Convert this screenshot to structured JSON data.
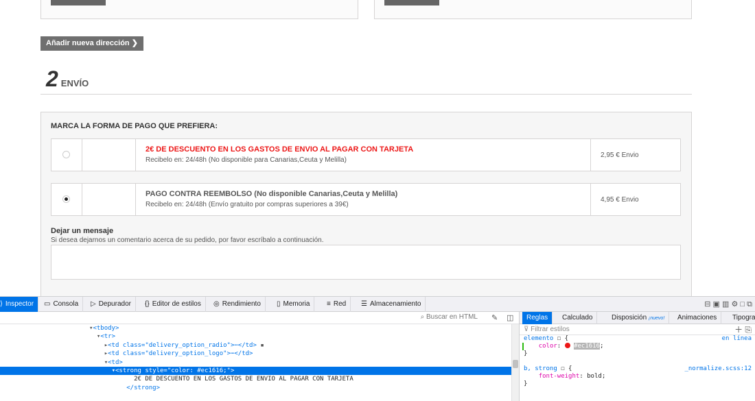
{
  "page": {
    "add_address_button": "Añadir nueva dirección",
    "step_number": "2",
    "step_title": "ENVÍO",
    "payment_heading": "MARCA LA FORMA DE PAGO QUE PREFIERA:",
    "options": [
      {
        "title": "2€ DE DESCUENTO EN LOS GASTOS DE ENVIO AL PAGAR CON TARJETA",
        "subtitle": "Recibelo en: 24/48h (No disponible para Canarias,Ceuta y Melilla)",
        "price": "2,95 € Envio",
        "selected": false,
        "title_color": "#ec1616"
      },
      {
        "title": "PAGO CONTRA REEMBOLSO (No disponible Canarias,Ceuta y Melilla)",
        "subtitle": "Recibelo en: 24/48h (Envío gratuito por compras superiores a 39€)",
        "price": "4,95 € Envio",
        "selected": true,
        "title_color": "#555555"
      }
    ],
    "message_label": "Dejar un mensaje",
    "message_hint": "Si desea dejarnos un comentario acerca de su pedido, por favor escríbalo a continuación."
  },
  "devtools": {
    "tabs": [
      {
        "label": "Inspector",
        "icon": "inspector-icon",
        "active": true
      },
      {
        "label": "Consola",
        "icon": "console-icon"
      },
      {
        "label": "Depurador",
        "icon": "debugger-icon"
      },
      {
        "label": "Editor de estilos",
        "icon": "style-editor-icon"
      },
      {
        "label": "Rendimiento",
        "icon": "performance-icon"
      },
      {
        "label": "Memoria",
        "icon": "memory-icon"
      },
      {
        "label": "Red",
        "icon": "network-icon"
      },
      {
        "label": "Almacenamiento",
        "icon": "storage-icon"
      }
    ],
    "search_placeholder": "Buscar en HTML",
    "tree": [
      {
        "text": "<tbody>"
      },
      {
        "text": "<tr>"
      },
      {
        "text": "<td class=\"delivery_option_radio\">⋯</td>"
      },
      {
        "text": "<td class=\"delivery_option_logo\">⋯</td>"
      },
      {
        "text": "<td>"
      },
      {
        "text": "<strong style=\"color: #ec1616;\">",
        "selected": true
      },
      {
        "text": "2€ DE DESCUENTO EN LOS GASTOS DE ENVIO AL PAGAR CON TARJETA"
      },
      {
        "text": "</strong>"
      }
    ],
    "rule_tabs": [
      {
        "label": "Reglas",
        "active": true
      },
      {
        "label": "Calculado"
      },
      {
        "label": "Disposición",
        "badge": "¡nuevo!"
      },
      {
        "label": "Animaciones"
      },
      {
        "label": "Tipografías"
      }
    ],
    "filter_placeholder": "Filtrar estilos",
    "rules": {
      "element_selector": "elemento",
      "element_source": "en línea",
      "color_prop": "color",
      "color_value": "#ec1616",
      "rule2_selector": "b, strong",
      "rule2_source": "_normalize.scss:12",
      "rule2_prop": "font-weight",
      "rule2_value": "bold"
    }
  }
}
